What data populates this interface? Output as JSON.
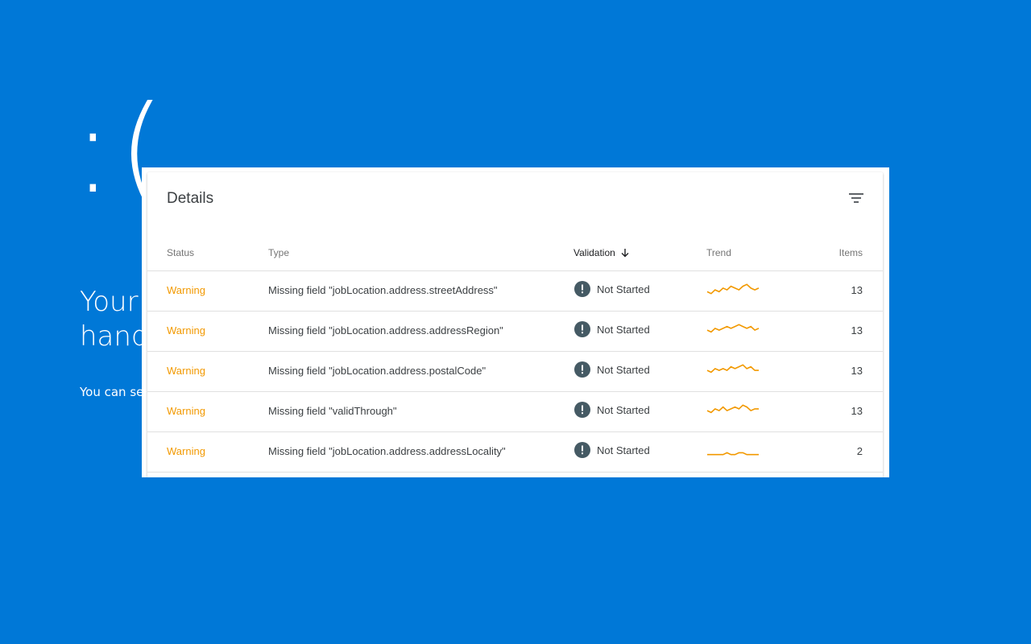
{
  "background": {
    "color": "#0078d7",
    "sad_face": ":(",
    "title": "Your\nhand",
    "subtitle": "You can se"
  },
  "details": {
    "title": "Details",
    "filter_icon": "filter-list-icon",
    "columns": {
      "status": "Status",
      "type": "Type",
      "validation": "Validation",
      "trend": "Trend",
      "items": "Items"
    },
    "sort_icon": "arrow-down-icon",
    "warning_color": "#f29900",
    "rows": [
      {
        "status": "Warning",
        "type": "Missing field \"jobLocation.address.streetAddress\"",
        "validation": "Not Started",
        "trend": [
          2,
          1,
          3,
          2,
          4,
          3,
          5,
          4,
          3,
          5,
          6,
          4,
          3,
          4
        ],
        "items": "13"
      },
      {
        "status": "Warning",
        "type": "Missing field \"jobLocation.address.addressRegion\"",
        "validation": "Not Started",
        "trend": [
          3,
          2,
          4,
          3,
          4,
          5,
          4,
          5,
          6,
          5,
          4,
          5,
          3,
          4
        ],
        "items": "13"
      },
      {
        "status": "Warning",
        "type": "Missing field \"jobLocation.address.postalCode\"",
        "validation": "Not Started",
        "trend": [
          3,
          2,
          4,
          3,
          4,
          3,
          5,
          4,
          5,
          6,
          4,
          5,
          3,
          3
        ],
        "items": "13"
      },
      {
        "status": "Warning",
        "type": "Missing field \"validThrough\"",
        "validation": "Not Started",
        "trend": [
          3,
          2,
          4,
          3,
          5,
          3,
          4,
          5,
          4,
          6,
          5,
          3,
          4,
          4
        ],
        "items": "13"
      },
      {
        "status": "Warning",
        "type": "Missing field \"jobLocation.address.addressLocality\"",
        "validation": "Not Started",
        "trend": [
          1,
          1,
          1,
          1,
          1,
          2,
          1,
          1,
          2,
          2,
          1,
          1,
          1,
          1
        ],
        "items": "2"
      }
    ]
  }
}
